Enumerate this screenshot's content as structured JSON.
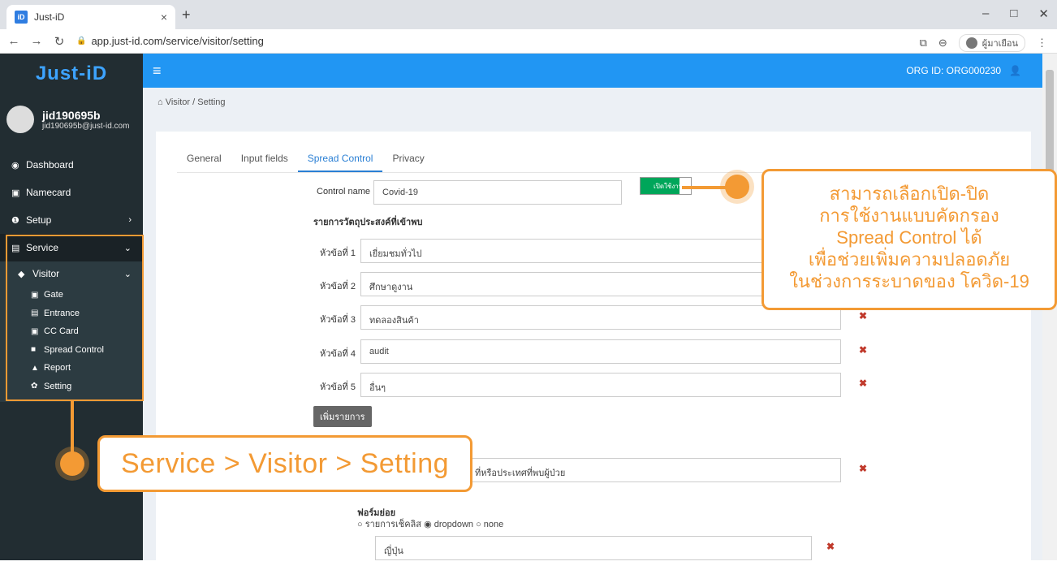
{
  "browser": {
    "tab_title": "Just-iD",
    "tab_fav": "iD",
    "url": "app.just-id.com/service/visitor/setting",
    "guest_label": "ผู้มาเยือน"
  },
  "sidebar": {
    "brand": "Just-iD",
    "user_name": "jid190695b",
    "user_email": "jid190695b@just-id.com",
    "items": [
      {
        "label": "Dashboard"
      },
      {
        "label": "Namecard"
      },
      {
        "label": "Setup"
      },
      {
        "label": "Service"
      }
    ],
    "visitor_label": "Visitor",
    "sub_items": [
      {
        "label": "Gate"
      },
      {
        "label": "Entrance"
      },
      {
        "label": "CC Card"
      },
      {
        "label": "Spread Control"
      },
      {
        "label": "Report"
      },
      {
        "label": "Setting"
      }
    ]
  },
  "topbar": {
    "org_id": "ORG ID: ORG000230"
  },
  "breadcrumb": "Visitor / Setting",
  "tabs": [
    "General",
    "Input fields",
    "Spread Control",
    "Privacy"
  ],
  "form": {
    "control_name_label": "Control name",
    "control_name_value": "Covid-19",
    "toggle_label": "เปิดใช้งาน",
    "purpose_heading": "รายการวัตถุประสงค์ที่เข้าพบ",
    "rows": [
      {
        "label": "หัวข้อที่ 1",
        "value": "เยี่ยมชมทั่วไป"
      },
      {
        "label": "หัวข้อที่ 2",
        "value": "ศึกษาดูงาน"
      },
      {
        "label": "หัวข้อที่ 3",
        "value": "ทดลองสินค้า"
      },
      {
        "label": "หัวข้อที่ 4",
        "value": "audit"
      },
      {
        "label": "หัวข้อที่ 5",
        "value": "อื่นๆ"
      }
    ],
    "add_button": "เพิ่มรายการ",
    "question_value": "ที่หรือประเทศที่พบผู้ป่วย",
    "subform_label": "ฟอร์มย่อย",
    "radio_options": "○ รายการเช็คลิส ◉ dropdown ○ none",
    "sub_value": "ญี่ปุ่น"
  },
  "callouts": {
    "right_lines": [
      "สามารถเลือกเปิด-ปิด",
      "การใช้งานแบบคัดกรอง",
      "Spread Control ได้",
      "เพื่อช่วยเพิ่มความปลอดภัย",
      "ในช่วงการระบาดของ โควิด-19"
    ],
    "left_text": "Service > Visitor > Setting"
  },
  "colors": {
    "accent": "#f39a34",
    "topbar": "#2196f3",
    "sidebar": "#222d32",
    "toggle_on": "#00a65a"
  }
}
